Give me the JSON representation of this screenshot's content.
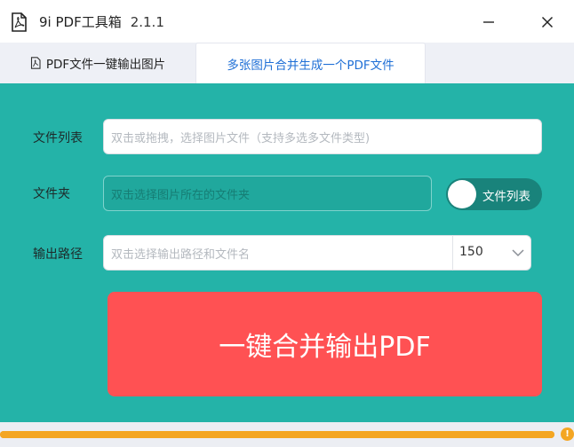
{
  "window": {
    "title": "9i PDF工具箱",
    "version": "2.1.1",
    "icons": {
      "app": "pdf-file-icon",
      "minimize": "minimize-icon",
      "close": "close-icon"
    }
  },
  "tabs": [
    {
      "label": "PDF文件一键输出图片",
      "icon": "pdf-file-icon",
      "active": false
    },
    {
      "label": "多张图片合并生成一个PDF文件",
      "active": true
    }
  ],
  "form": {
    "file_list": {
      "label": "文件列表",
      "placeholder": "双击或拖拽，选择图片文件（支持多选多文件类型)"
    },
    "folder": {
      "label": "文件夹",
      "placeholder": "双击选择图片所在的文件夹"
    },
    "toggle": {
      "label": "文件列表",
      "on": true
    },
    "output": {
      "label": "输出路径",
      "placeholder": "双击选择输出路径和文件名",
      "dpi_value": "150"
    }
  },
  "merge_button": {
    "label": "一键合并输出PDF"
  },
  "progress": {
    "value": 1.0,
    "warning_icon": "warning-icon",
    "warning_glyph": "!"
  },
  "colors": {
    "panel": "#24b3a8",
    "active_tab_text": "#1f6fd6",
    "merge_button": "#ff5153",
    "progress": "#f4a623"
  }
}
